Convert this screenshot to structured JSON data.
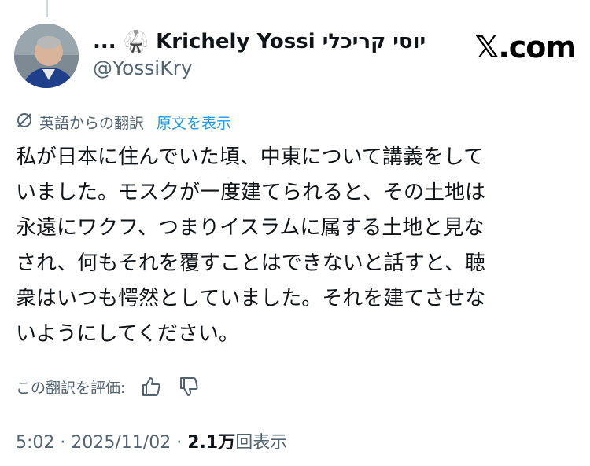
{
  "author": {
    "display_name": "... 🥋 Krichely Yossi יוסי קריכלי",
    "handle": "@YossiKry"
  },
  "source_brand": "𝕏.com",
  "translation": {
    "label": "英語からの翻訳",
    "show_original": "原文を表示"
  },
  "tweet": {
    "lines": [
      "私が日本に住んでいた頃、中東について講義をして",
      "いました。モスクが一度建てられると、その土地は",
      "永遠にワクフ、つまりイスラムに属する土地と見な",
      "され、何もそれを覆すことはできないと話すと、聴",
      "衆はいつも愕然としていました。それを建てさせな",
      "いようにしてください。"
    ]
  },
  "rating": {
    "label": "この翻訳を評価:"
  },
  "meta": {
    "time": "5:02",
    "separator": "·",
    "date": "2025/11/02",
    "views_count": "2.1万",
    "views_label": "回表示"
  },
  "colors": {
    "text": "#0f1419",
    "secondary": "#536471",
    "link": "#1d9bf0",
    "thread_line": "#cfd9de"
  }
}
